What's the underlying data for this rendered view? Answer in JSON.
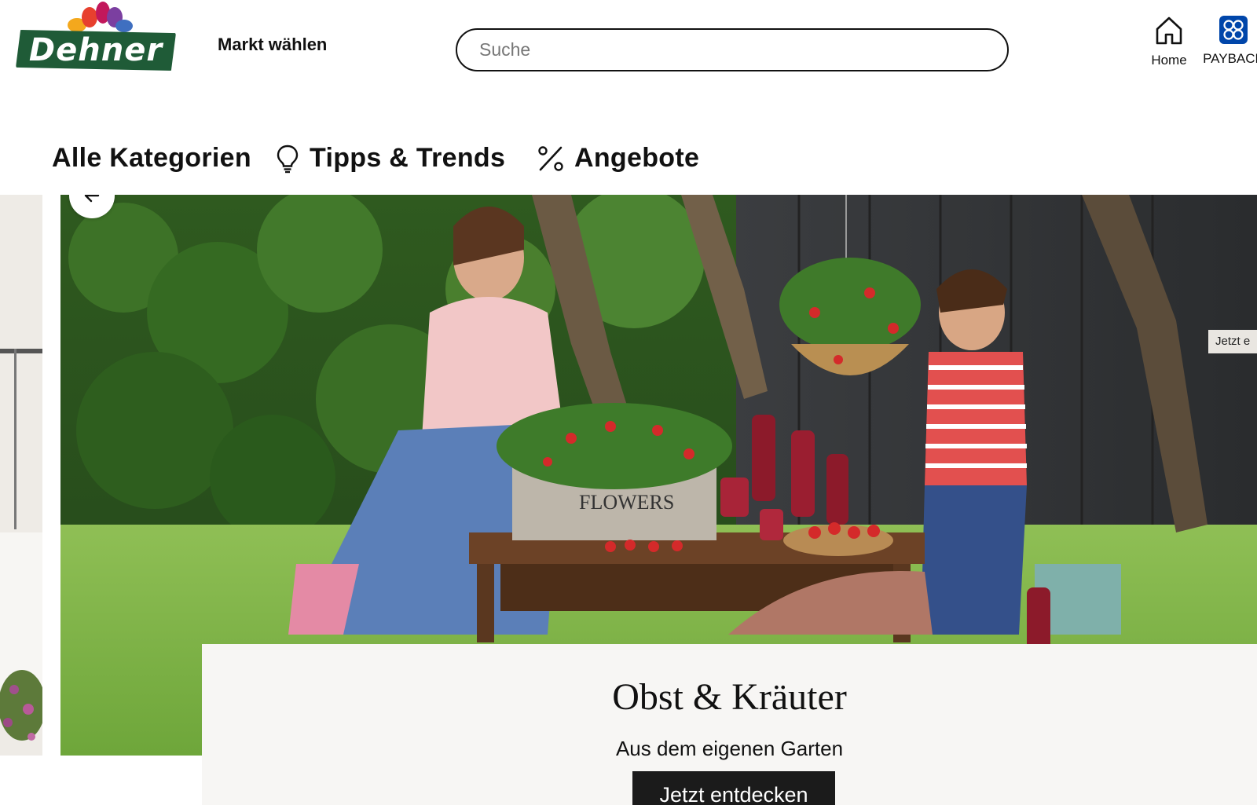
{
  "header": {
    "logo_text": "Dehner",
    "market_label": "Markt wählen",
    "search": {
      "placeholder": "Suche",
      "value": ""
    },
    "home_label": "Home",
    "payback_label": "PAYBACK"
  },
  "nav": {
    "categories_label": "Alle Kategorien",
    "tips_label": "Tipps & Trends",
    "offers_label": "Angebote"
  },
  "hero": {
    "title": "Obst & Kräuter",
    "subtitle": "Aus dem eigenen Garten",
    "cta_label": "Jetzt entdecken",
    "next_slide_label": "Jetzt e",
    "box_text": "FLOWERS"
  },
  "colors": {
    "brand_green": "#1f5b37",
    "payback_blue": "#0046aa",
    "cta_bg": "#1b1b1b",
    "content_box_bg": "#f7f6f4"
  },
  "icons": [
    "home-icon",
    "payback-icon",
    "lightbulb-icon",
    "percent-icon",
    "arrow-left-icon"
  ]
}
